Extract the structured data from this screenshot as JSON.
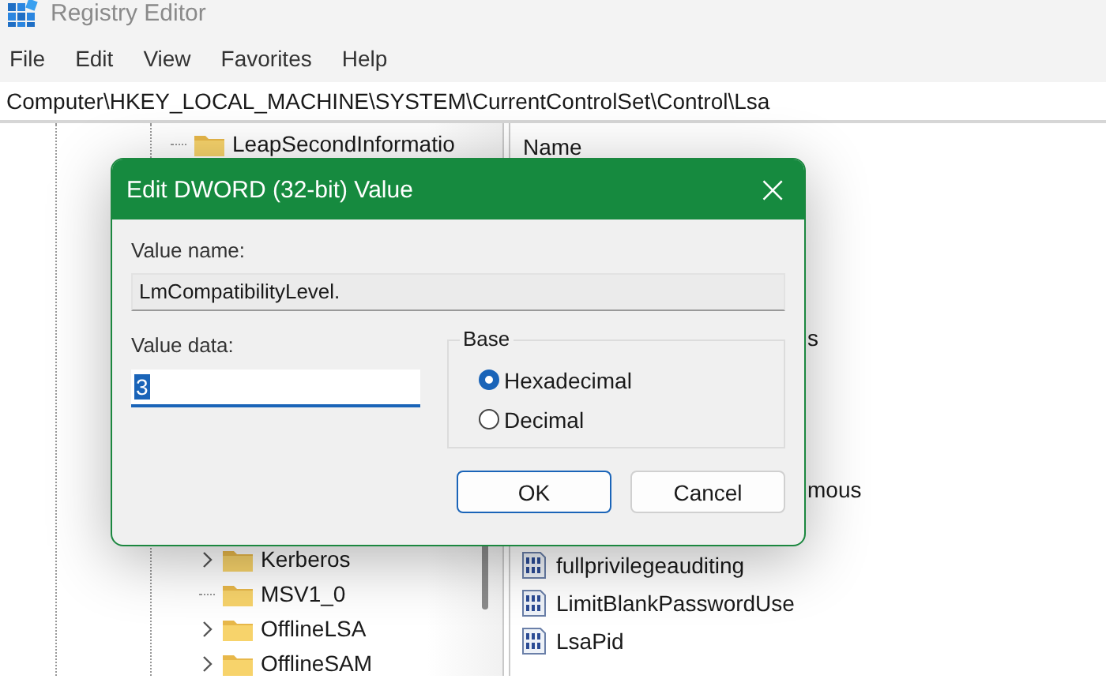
{
  "window": {
    "title": "Registry Editor"
  },
  "menu": [
    "File",
    "Edit",
    "View",
    "Favorites",
    "Help"
  ],
  "address": "Computer\\HKEY_LOCAL_MACHINE\\SYSTEM\\CurrentControlSet\\Control\\Lsa",
  "tree": {
    "items": [
      {
        "label": "LeapSecondInformatio",
        "expandable": false
      }
    ],
    "lower_items": [
      {
        "label": "Kerberos",
        "expandable": true
      },
      {
        "label": "MSV1_0",
        "expandable": false
      },
      {
        "label": "OfflineLSA",
        "expandable": true
      },
      {
        "label": "OfflineSAM",
        "expandable": true
      }
    ]
  },
  "values": {
    "header": "Name",
    "items": [
      {
        "kind": "peek",
        "label": "s"
      },
      {
        "kind": "peek",
        "label": "mous"
      },
      {
        "kind": "value",
        "label": "fullprivilegeauditing"
      },
      {
        "kind": "value",
        "label": "LimitBlankPasswordUse"
      },
      {
        "kind": "value",
        "label": "LsaPid"
      }
    ]
  },
  "dialog": {
    "title": "Edit DWORD (32-bit) Value",
    "close": "×",
    "value_name_label": "Value name:",
    "value_name": "LmCompatibilityLevel.",
    "value_data_label": "Value data:",
    "value_data": "3",
    "base_label": "Base",
    "bases": [
      {
        "label": "Hexadecimal",
        "selected": true
      },
      {
        "label": "Decimal",
        "selected": false
      }
    ],
    "buttons": [
      {
        "label": "OK",
        "default": true
      },
      {
        "label": "Cancel",
        "default": false
      }
    ]
  }
}
